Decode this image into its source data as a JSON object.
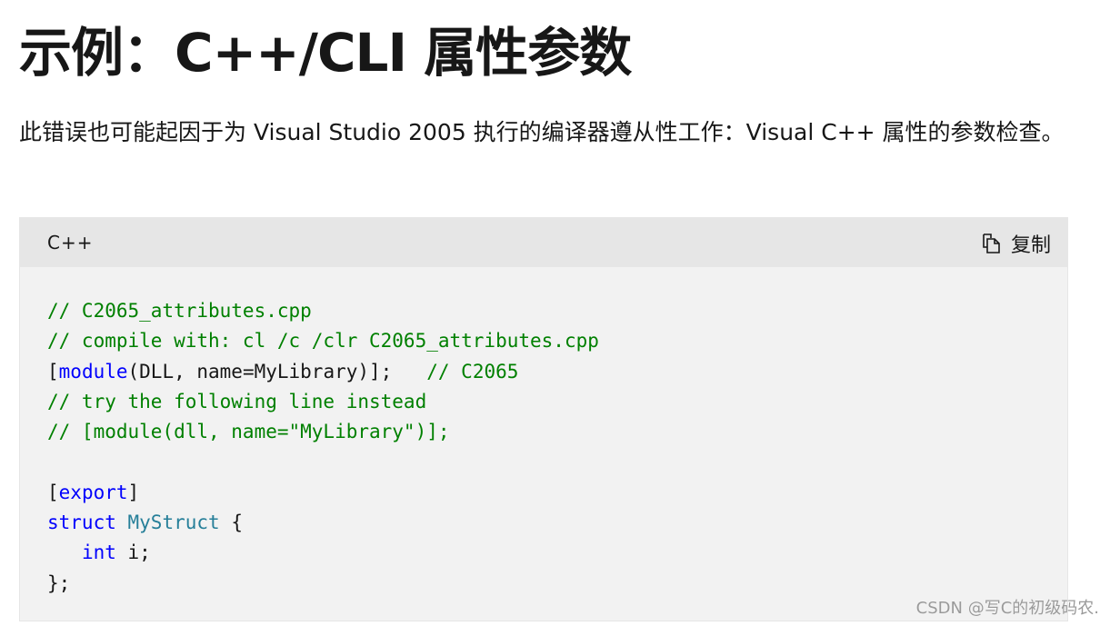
{
  "page": {
    "title": "示例：C++/CLI 属性参数",
    "description": "此错误也可能起因于为 Visual Studio 2005 执行的编译器遵从性工作：Visual C++ 属性的参数检查。"
  },
  "code_block": {
    "language": "C++",
    "copy_label": "复制",
    "copy_icon": "copy-icon",
    "lines": [
      [
        {
          "t": "comment",
          "v": "// C2065_attributes.cpp"
        }
      ],
      [
        {
          "t": "comment",
          "v": "// compile with: cl /c /clr C2065_attributes.cpp"
        }
      ],
      [
        {
          "t": "plain",
          "v": "["
        },
        {
          "t": "keyword",
          "v": "module"
        },
        {
          "t": "plain",
          "v": "(DLL, name=MyLibrary)];   "
        },
        {
          "t": "comment",
          "v": "// C2065"
        }
      ],
      [
        {
          "t": "comment",
          "v": "// try the following line instead"
        }
      ],
      [
        {
          "t": "comment",
          "v": "// [module(dll, name=\"MyLibrary\")];"
        }
      ],
      [
        {
          "t": "plain",
          "v": ""
        }
      ],
      [
        {
          "t": "plain",
          "v": "["
        },
        {
          "t": "keyword",
          "v": "export"
        },
        {
          "t": "plain",
          "v": "]"
        }
      ],
      [
        {
          "t": "keyword",
          "v": "struct"
        },
        {
          "t": "plain",
          "v": " "
        },
        {
          "t": "type",
          "v": "MyStruct"
        },
        {
          "t": "plain",
          "v": " {"
        }
      ],
      [
        {
          "t": "plain",
          "v": "   "
        },
        {
          "t": "keyword",
          "v": "int"
        },
        {
          "t": "plain",
          "v": " i;"
        }
      ],
      [
        {
          "t": "plain",
          "v": "};"
        }
      ]
    ]
  },
  "watermark": "CSDN @写C的初级码农."
}
